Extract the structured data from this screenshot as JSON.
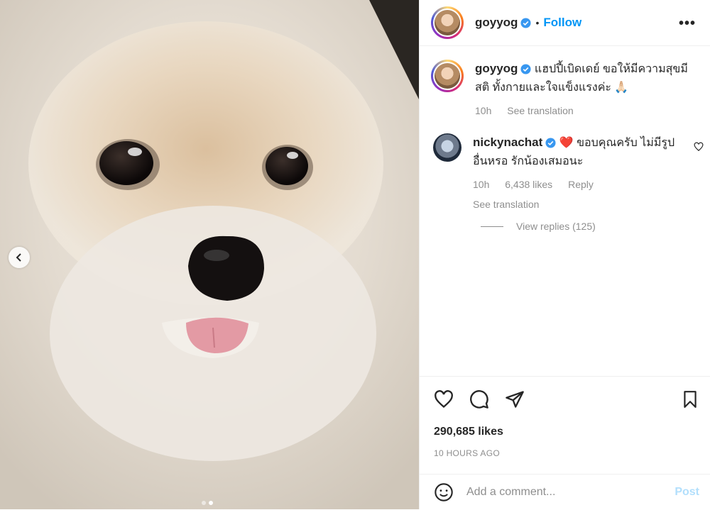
{
  "post": {
    "author": "goyyog",
    "follow_label": "Follow",
    "bullet": "•",
    "more": "•••"
  },
  "caption": {
    "username": "goyyog",
    "text": "แฮปปี้เบิดเดย์ ขอให้มีความสุขมีสติ ทั้งกายและใจแข็งแรงค่ะ 🙏🏻",
    "time": "10h",
    "see_translation": "See translation"
  },
  "comment": {
    "username": "nickynachat",
    "heart_emoji": "❤️",
    "text": "ขอบคุณครับ ไม่มีรูปอื่นหรอ รักน้องเสมอนะ",
    "time": "10h",
    "likes": "6,438 likes",
    "reply": "Reply",
    "see_translation": "See translation",
    "view_replies": "View replies (125)"
  },
  "stats": {
    "likes": "290,685 likes",
    "time_ago": "10 HOURS AGO"
  },
  "composer": {
    "placeholder": "Add a comment...",
    "post_label": "Post"
  },
  "carousel": {
    "current_index": 2,
    "count": 2
  },
  "colors": {
    "link": "#0095f6",
    "verified": "#3897f0",
    "muted": "#8e8e8e",
    "post_disabled": "#b2dffc"
  }
}
